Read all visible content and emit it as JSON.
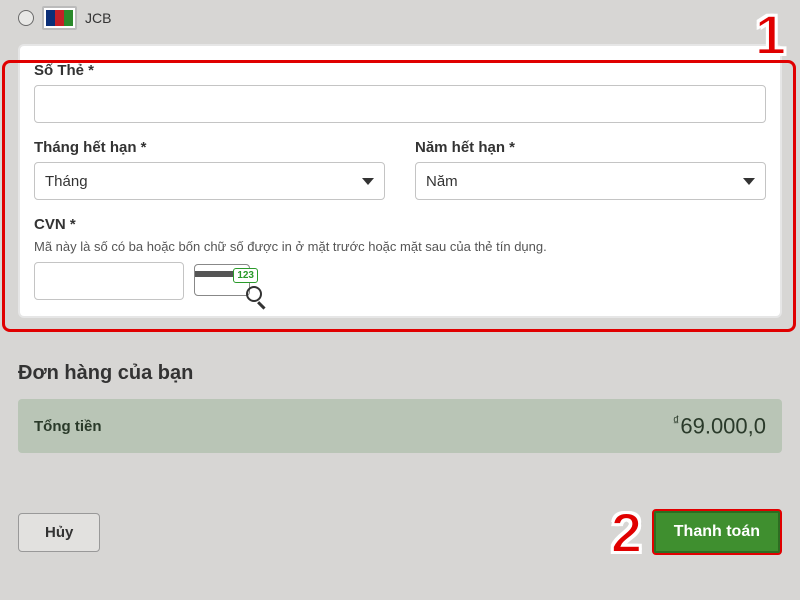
{
  "payment_option": {
    "jcb_label": "JCB"
  },
  "form": {
    "card_number_label": "Số Thẻ *",
    "exp_month_label": "Tháng hết hạn *",
    "exp_month_placeholder": "Tháng",
    "exp_year_label": "Năm hết hạn *",
    "exp_year_placeholder": "Năm",
    "cvn_label": "CVN *",
    "cvn_hint": "Mã này là số có ba hoặc bốn chữ số được in ở mặt trước hoặc mặt sau của thẻ tín dụng.",
    "cvn_icon_digits": "123"
  },
  "order": {
    "heading": "Đơn hàng của bạn",
    "total_label": "Tổng tiền",
    "currency_symbol": "₫",
    "total_value": "69.000,0"
  },
  "actions": {
    "cancel": "Hủy",
    "pay": "Thanh toán"
  },
  "annotations": {
    "step1": "1",
    "step2": "2"
  }
}
